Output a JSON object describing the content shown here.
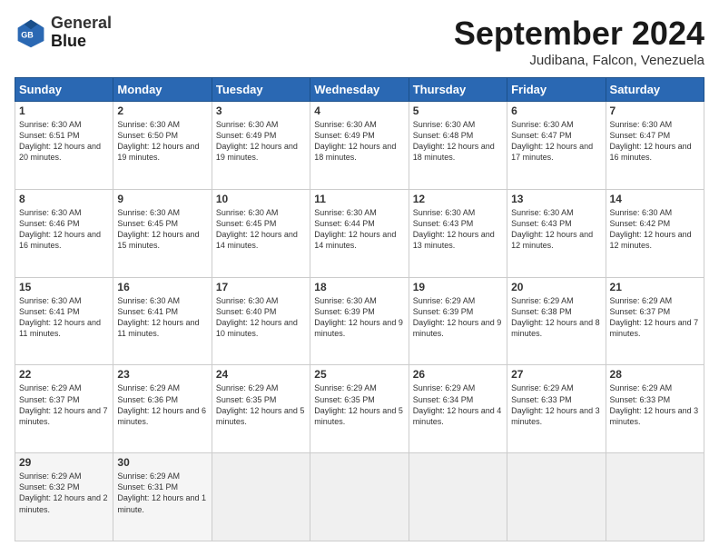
{
  "logo": {
    "line1": "General",
    "line2": "Blue"
  },
  "title": "September 2024",
  "location": "Judibana, Falcon, Venezuela",
  "days_header": [
    "Sunday",
    "Monday",
    "Tuesday",
    "Wednesday",
    "Thursday",
    "Friday",
    "Saturday"
  ],
  "weeks": [
    [
      {
        "num": "1",
        "sunrise": "6:30 AM",
        "sunset": "6:51 PM",
        "daylight": "12 hours and 20 minutes."
      },
      {
        "num": "2",
        "sunrise": "6:30 AM",
        "sunset": "6:50 PM",
        "daylight": "12 hours and 19 minutes."
      },
      {
        "num": "3",
        "sunrise": "6:30 AM",
        "sunset": "6:49 PM",
        "daylight": "12 hours and 19 minutes."
      },
      {
        "num": "4",
        "sunrise": "6:30 AM",
        "sunset": "6:49 PM",
        "daylight": "12 hours and 18 minutes."
      },
      {
        "num": "5",
        "sunrise": "6:30 AM",
        "sunset": "6:48 PM",
        "daylight": "12 hours and 18 minutes."
      },
      {
        "num": "6",
        "sunrise": "6:30 AM",
        "sunset": "6:47 PM",
        "daylight": "12 hours and 17 minutes."
      },
      {
        "num": "7",
        "sunrise": "6:30 AM",
        "sunset": "6:47 PM",
        "daylight": "12 hours and 16 minutes."
      }
    ],
    [
      {
        "num": "8",
        "sunrise": "6:30 AM",
        "sunset": "6:46 PM",
        "daylight": "12 hours and 16 minutes."
      },
      {
        "num": "9",
        "sunrise": "6:30 AM",
        "sunset": "6:45 PM",
        "daylight": "12 hours and 15 minutes."
      },
      {
        "num": "10",
        "sunrise": "6:30 AM",
        "sunset": "6:45 PM",
        "daylight": "12 hours and 14 minutes."
      },
      {
        "num": "11",
        "sunrise": "6:30 AM",
        "sunset": "6:44 PM",
        "daylight": "12 hours and 14 minutes."
      },
      {
        "num": "12",
        "sunrise": "6:30 AM",
        "sunset": "6:43 PM",
        "daylight": "12 hours and 13 minutes."
      },
      {
        "num": "13",
        "sunrise": "6:30 AM",
        "sunset": "6:43 PM",
        "daylight": "12 hours and 12 minutes."
      },
      {
        "num": "14",
        "sunrise": "6:30 AM",
        "sunset": "6:42 PM",
        "daylight": "12 hours and 12 minutes."
      }
    ],
    [
      {
        "num": "15",
        "sunrise": "6:30 AM",
        "sunset": "6:41 PM",
        "daylight": "12 hours and 11 minutes."
      },
      {
        "num": "16",
        "sunrise": "6:30 AM",
        "sunset": "6:41 PM",
        "daylight": "12 hours and 11 minutes."
      },
      {
        "num": "17",
        "sunrise": "6:30 AM",
        "sunset": "6:40 PM",
        "daylight": "12 hours and 10 minutes."
      },
      {
        "num": "18",
        "sunrise": "6:30 AM",
        "sunset": "6:39 PM",
        "daylight": "12 hours and 9 minutes."
      },
      {
        "num": "19",
        "sunrise": "6:29 AM",
        "sunset": "6:39 PM",
        "daylight": "12 hours and 9 minutes."
      },
      {
        "num": "20",
        "sunrise": "6:29 AM",
        "sunset": "6:38 PM",
        "daylight": "12 hours and 8 minutes."
      },
      {
        "num": "21",
        "sunrise": "6:29 AM",
        "sunset": "6:37 PM",
        "daylight": "12 hours and 7 minutes."
      }
    ],
    [
      {
        "num": "22",
        "sunrise": "6:29 AM",
        "sunset": "6:37 PM",
        "daylight": "12 hours and 7 minutes."
      },
      {
        "num": "23",
        "sunrise": "6:29 AM",
        "sunset": "6:36 PM",
        "daylight": "12 hours and 6 minutes."
      },
      {
        "num": "24",
        "sunrise": "6:29 AM",
        "sunset": "6:35 PM",
        "daylight": "12 hours and 5 minutes."
      },
      {
        "num": "25",
        "sunrise": "6:29 AM",
        "sunset": "6:35 PM",
        "daylight": "12 hours and 5 minutes."
      },
      {
        "num": "26",
        "sunrise": "6:29 AM",
        "sunset": "6:34 PM",
        "daylight": "12 hours and 4 minutes."
      },
      {
        "num": "27",
        "sunrise": "6:29 AM",
        "sunset": "6:33 PM",
        "daylight": "12 hours and 3 minutes."
      },
      {
        "num": "28",
        "sunrise": "6:29 AM",
        "sunset": "6:33 PM",
        "daylight": "12 hours and 3 minutes."
      }
    ],
    [
      {
        "num": "29",
        "sunrise": "6:29 AM",
        "sunset": "6:32 PM",
        "daylight": "12 hours and 2 minutes."
      },
      {
        "num": "30",
        "sunrise": "6:29 AM",
        "sunset": "6:31 PM",
        "daylight": "12 hours and 1 minute."
      },
      null,
      null,
      null,
      null,
      null
    ]
  ]
}
